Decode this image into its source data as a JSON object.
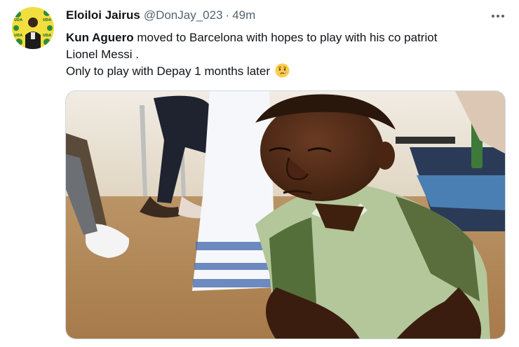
{
  "tweet": {
    "author": {
      "display_name": "Eloiloi Jairus",
      "handle": "@DonJay_023"
    },
    "separator": "·",
    "timestamp": "49m",
    "text": {
      "mention_name": "Kun Aguero",
      "line1_rest": " moved to Barcelona with hopes to play with his co patriot",
      "line2": "Lionel Messi .",
      "line3": "Only to play with Depay 1 months later",
      "emoji_icon": "crying-face-emoji"
    },
    "more_icon": "more-options-icon",
    "media": {
      "kind": "photo",
      "subject": "man in green polo shirt looking down sadly"
    }
  },
  "colors": {
    "text_primary": "#0f1419",
    "text_secondary": "#536471",
    "border": "#cfd9de",
    "background": "#ffffff"
  }
}
